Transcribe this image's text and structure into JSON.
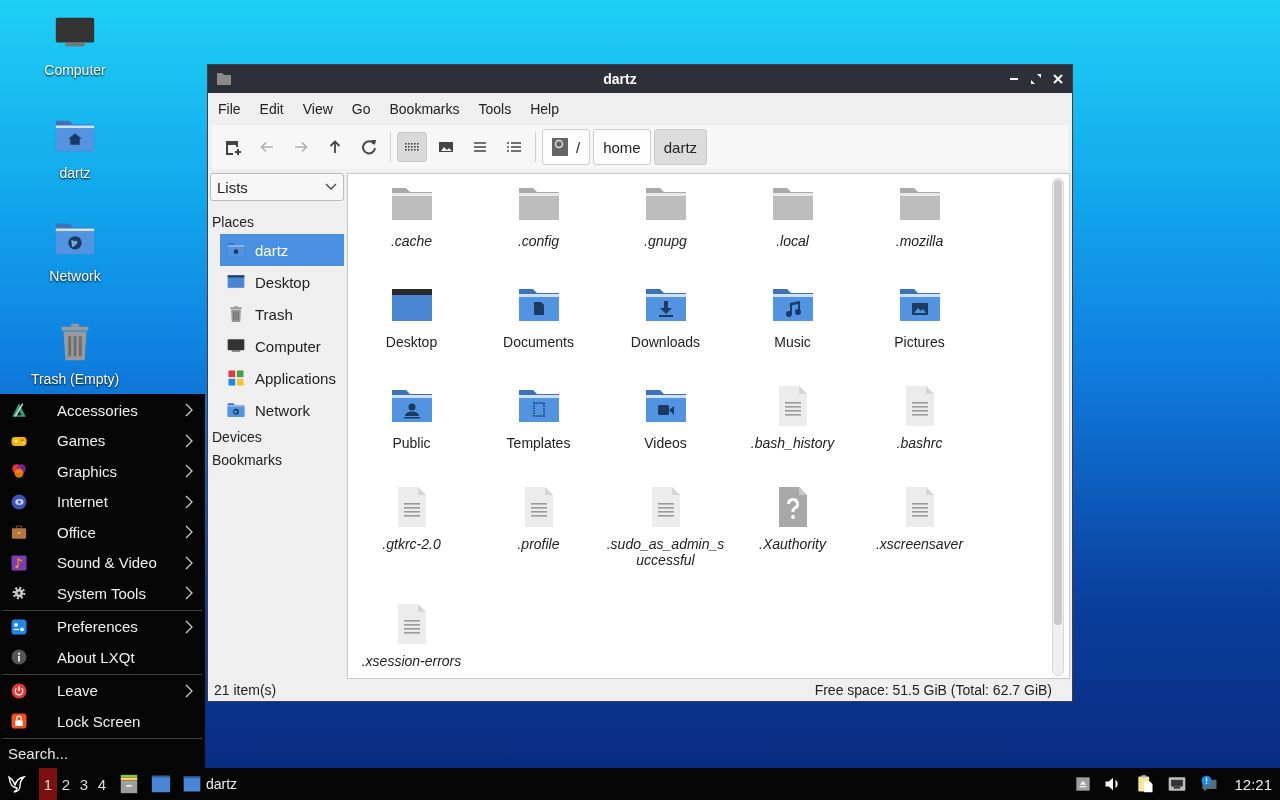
{
  "desktop_icons": [
    {
      "label": "Computer",
      "kind": "computer"
    },
    {
      "label": "dartz",
      "kind": "home"
    },
    {
      "label": "Network",
      "kind": "network"
    },
    {
      "label": "Trash (Empty)",
      "kind": "trash"
    }
  ],
  "window": {
    "title": "dartz",
    "menu": [
      "File",
      "Edit",
      "View",
      "Go",
      "Bookmarks",
      "Tools",
      "Help"
    ],
    "nav_buttons": [
      {
        "kind": "new-tab",
        "disabled": false
      },
      {
        "kind": "back",
        "disabled": true
      },
      {
        "kind": "forward",
        "disabled": true
      },
      {
        "kind": "up",
        "disabled": false
      },
      {
        "kind": "reload",
        "disabled": false
      }
    ],
    "view_modes": [
      {
        "kind": "icons",
        "selected": true
      },
      {
        "kind": "thumbnails",
        "selected": false
      },
      {
        "kind": "compact",
        "selected": false
      },
      {
        "kind": "details",
        "selected": false
      }
    ],
    "path": [
      {
        "label": "/",
        "kind": "root",
        "selected": false
      },
      {
        "label": "home",
        "kind": "folder",
        "selected": false
      },
      {
        "label": "dartz",
        "kind": "folder",
        "selected": true
      }
    ],
    "side_pane": {
      "mode": "Lists",
      "places_title": "Places",
      "places": [
        {
          "label": "dartz",
          "kind": "home",
          "selected": true
        },
        {
          "label": "Desktop",
          "kind": "monitor",
          "selected": false
        },
        {
          "label": "Trash",
          "kind": "trash",
          "selected": false
        },
        {
          "label": "Computer",
          "kind": "computer",
          "selected": false
        },
        {
          "label": "Applications",
          "kind": "applications",
          "selected": false
        },
        {
          "label": "Network",
          "kind": "network",
          "selected": false
        }
      ],
      "other_sections": [
        "Devices",
        "Bookmarks"
      ]
    },
    "files": [
      {
        "name": ".cache",
        "kind": "folder",
        "hidden": true
      },
      {
        "name": ".config",
        "kind": "folder",
        "hidden": true
      },
      {
        "name": ".gnupg",
        "kind": "folder",
        "hidden": true
      },
      {
        "name": ".local",
        "kind": "folder",
        "hidden": true
      },
      {
        "name": ".mozilla",
        "kind": "folder",
        "hidden": true
      },
      {
        "name": "Desktop",
        "kind": "desktop",
        "hidden": false
      },
      {
        "name": "Documents",
        "kind": "documents",
        "hidden": false
      },
      {
        "name": "Downloads",
        "kind": "downloads",
        "hidden": false
      },
      {
        "name": "Music",
        "kind": "music",
        "hidden": false
      },
      {
        "name": "Pictures",
        "kind": "pictures",
        "hidden": false
      },
      {
        "name": "Public",
        "kind": "public",
        "hidden": false
      },
      {
        "name": "Templates",
        "kind": "templates",
        "hidden": false
      },
      {
        "name": "Videos",
        "kind": "videos",
        "hidden": false
      },
      {
        "name": ".bash_history",
        "kind": "file",
        "hidden": true
      },
      {
        "name": ".bashrc",
        "kind": "file",
        "hidden": true
      },
      {
        "name": ".gtkrc-2.0",
        "kind": "file",
        "hidden": true
      },
      {
        "name": ".profile",
        "kind": "file",
        "hidden": true
      },
      {
        "name": ".sudo_as_admin_successful",
        "kind": "file",
        "hidden": true
      },
      {
        "name": ".Xauthority",
        "kind": "unknown",
        "hidden": true
      },
      {
        "name": ".xscreensaver",
        "kind": "file",
        "hidden": true
      },
      {
        "name": ".xsession-errors",
        "kind": "file",
        "hidden": true
      }
    ],
    "status_bar": {
      "count": "21 item(s)",
      "free_space": "Free space: 51.5 GiB (Total: 62.7 GiB)"
    }
  },
  "start_menu": {
    "sections": [
      [
        {
          "label": "Accessories",
          "kind": "accessories",
          "submenu": true
        },
        {
          "label": "Games",
          "kind": "games",
          "submenu": true
        },
        {
          "label": "Graphics",
          "kind": "graphics",
          "submenu": true
        },
        {
          "label": "Internet",
          "kind": "internet",
          "submenu": true
        },
        {
          "label": "Office",
          "kind": "office",
          "submenu": true
        },
        {
          "label": "Sound & Video",
          "kind": "sound",
          "submenu": true
        },
        {
          "label": "System Tools",
          "kind": "system",
          "submenu": true
        }
      ],
      [
        {
          "label": "Preferences",
          "kind": "preferences",
          "submenu": true
        },
        {
          "label": "About LXQt",
          "kind": "about",
          "submenu": false
        }
      ],
      [
        {
          "label": "Leave",
          "kind": "leave",
          "submenu": true
        },
        {
          "label": "Lock Screen",
          "kind": "lock",
          "submenu": false
        }
      ]
    ],
    "search": {
      "placeholder": "Search..."
    }
  },
  "taskbar": {
    "desktops": [
      {
        "label": "1",
        "selected": true
      },
      {
        "label": "2",
        "selected": false
      },
      {
        "label": "3",
        "selected": false
      },
      {
        "label": "4",
        "selected": false
      }
    ],
    "launchers": [
      {
        "kind": "file-manager"
      },
      {
        "kind": "show-desktop"
      }
    ],
    "tasks": [
      {
        "label": "dartz",
        "kind": "folder"
      }
    ],
    "tray": [
      {
        "kind": "eject"
      },
      {
        "kind": "volume"
      },
      {
        "kind": "clipboard"
      },
      {
        "kind": "network"
      },
      {
        "kind": "notification"
      }
    ],
    "clock": "12:21"
  }
}
